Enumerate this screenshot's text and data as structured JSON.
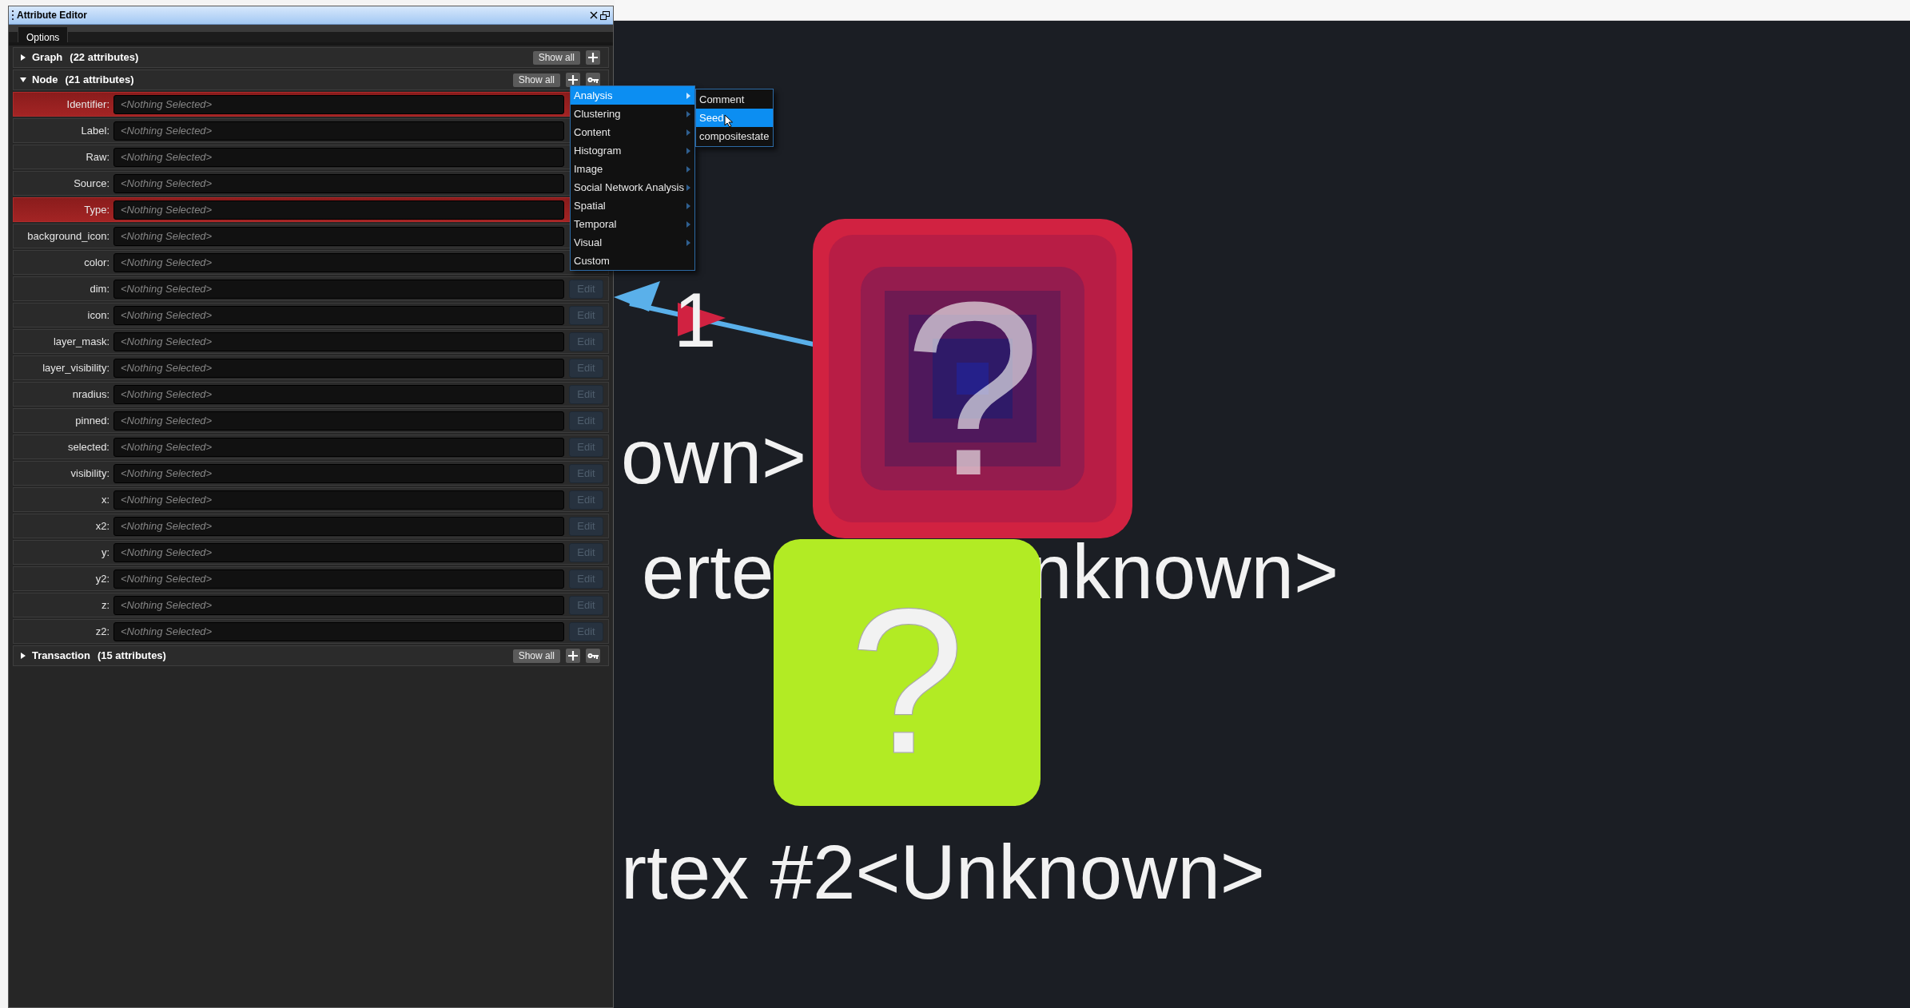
{
  "panel": {
    "title": "Attribute Editor",
    "tabs": [
      {
        "label": "Options",
        "selected": true
      }
    ],
    "sections": [
      {
        "title": "Graph",
        "count": "(22 attributes)",
        "expanded": false,
        "show_all": "Show all",
        "add_button": true,
        "key_button": false
      },
      {
        "title": "Node",
        "count": "(21 attributes)",
        "expanded": true,
        "show_all": "Show all",
        "add_button": true,
        "key_button": true,
        "rows": [
          {
            "label": "Identifier:",
            "placeholder": "<Nothing Selected>",
            "key": true
          },
          {
            "label": "Label:",
            "placeholder": "<Nothing Selected>",
            "key": false
          },
          {
            "label": "Raw:",
            "placeholder": "<Nothing Selected>",
            "key": false
          },
          {
            "label": "Source:",
            "placeholder": "<Nothing Selected>",
            "key": false
          },
          {
            "label": "Type:",
            "placeholder": "<Nothing Selected>",
            "key": true
          },
          {
            "label": "background_icon:",
            "placeholder": "<Nothing Selected>",
            "key": false
          },
          {
            "label": "color:",
            "placeholder": "<Nothing Selected>",
            "key": false
          },
          {
            "label": "dim:",
            "placeholder": "<Nothing Selected>",
            "key": false,
            "edit": {
              "label": "Edit",
              "disabled": true
            }
          },
          {
            "label": "icon:",
            "placeholder": "<Nothing Selected>",
            "key": false,
            "edit": {
              "label": "Edit",
              "disabled": true
            }
          },
          {
            "label": "layer_mask:",
            "placeholder": "<Nothing Selected>",
            "key": false,
            "edit": {
              "label": "Edit",
              "disabled": true
            }
          },
          {
            "label": "layer_visibility:",
            "placeholder": "<Nothing Selected>",
            "key": false,
            "edit": {
              "label": "Edit",
              "disabled": true
            }
          },
          {
            "label": "nradius:",
            "placeholder": "<Nothing Selected>",
            "key": false,
            "edit": {
              "label": "Edit",
              "disabled": true
            }
          },
          {
            "label": "pinned:",
            "placeholder": "<Nothing Selected>",
            "key": false,
            "edit": {
              "label": "Edit",
              "disabled": true
            }
          },
          {
            "label": "selected:",
            "placeholder": "<Nothing Selected>",
            "key": false,
            "edit": {
              "label": "Edit",
              "disabled": true
            }
          },
          {
            "label": "visibility:",
            "placeholder": "<Nothing Selected>",
            "key": false,
            "edit": {
              "label": "Edit",
              "disabled": true
            }
          },
          {
            "label": "x:",
            "placeholder": "<Nothing Selected>",
            "key": false,
            "edit": {
              "label": "Edit",
              "disabled": true
            }
          },
          {
            "label": "x2:",
            "placeholder": "<Nothing Selected>",
            "key": false,
            "edit": {
              "label": "Edit",
              "disabled": true
            }
          },
          {
            "label": "y:",
            "placeholder": "<Nothing Selected>",
            "key": false,
            "edit": {
              "label": "Edit",
              "disabled": true
            }
          },
          {
            "label": "y2:",
            "placeholder": "<Nothing Selected>",
            "key": false,
            "edit": {
              "label": "Edit",
              "disabled": true
            }
          },
          {
            "label": "z:",
            "placeholder": "<Nothing Selected>",
            "key": false,
            "edit": {
              "label": "Edit",
              "disabled": true
            }
          },
          {
            "label": "z2:",
            "placeholder": "<Nothing Selected>",
            "key": false,
            "edit": {
              "label": "Edit",
              "disabled": true
            }
          }
        ]
      },
      {
        "title": "Transaction",
        "count": "(15 attributes)",
        "expanded": false,
        "show_all": "Show all",
        "add_button": true,
        "key_button": true
      }
    ]
  },
  "menu": {
    "items": [
      {
        "label": "Analysis",
        "selected": true,
        "has_submenu": true
      },
      {
        "label": "Clustering",
        "selected": false,
        "has_submenu": true
      },
      {
        "label": "Content",
        "selected": false,
        "has_submenu": true
      },
      {
        "label": "Histogram",
        "selected": false,
        "has_submenu": true
      },
      {
        "label": "Image",
        "selected": false,
        "has_submenu": true
      },
      {
        "label": "Social Network Analysis",
        "selected": false,
        "has_submenu": true
      },
      {
        "label": "Spatial",
        "selected": false,
        "has_submenu": true
      },
      {
        "label": "Temporal",
        "selected": false,
        "has_submenu": true
      },
      {
        "label": "Visual",
        "selected": false,
        "has_submenu": true
      },
      {
        "label": "Custom",
        "selected": false,
        "has_submenu": false
      }
    ],
    "submenu": [
      {
        "label": "Comment",
        "selected": false
      },
      {
        "label": "Seed",
        "selected": true
      },
      {
        "label": "compositestate",
        "selected": false
      }
    ]
  },
  "graph": {
    "labels": [
      {
        "text": "1",
        "kind": "edge"
      },
      {
        "text": "own>",
        "kind": "vertex"
      },
      {
        "text": "erte",
        "kind": "vertex"
      },
      {
        "text": "nknown>",
        "kind": "vertex"
      },
      {
        "text": "rtex #2<Unknown>",
        "kind": "vertex"
      }
    ],
    "nodes": [
      {
        "kind": "layered",
        "color": "#d12241",
        "glyph": "?"
      },
      {
        "kind": "flat",
        "color": "#b2eb24",
        "glyph": "?"
      }
    ]
  }
}
